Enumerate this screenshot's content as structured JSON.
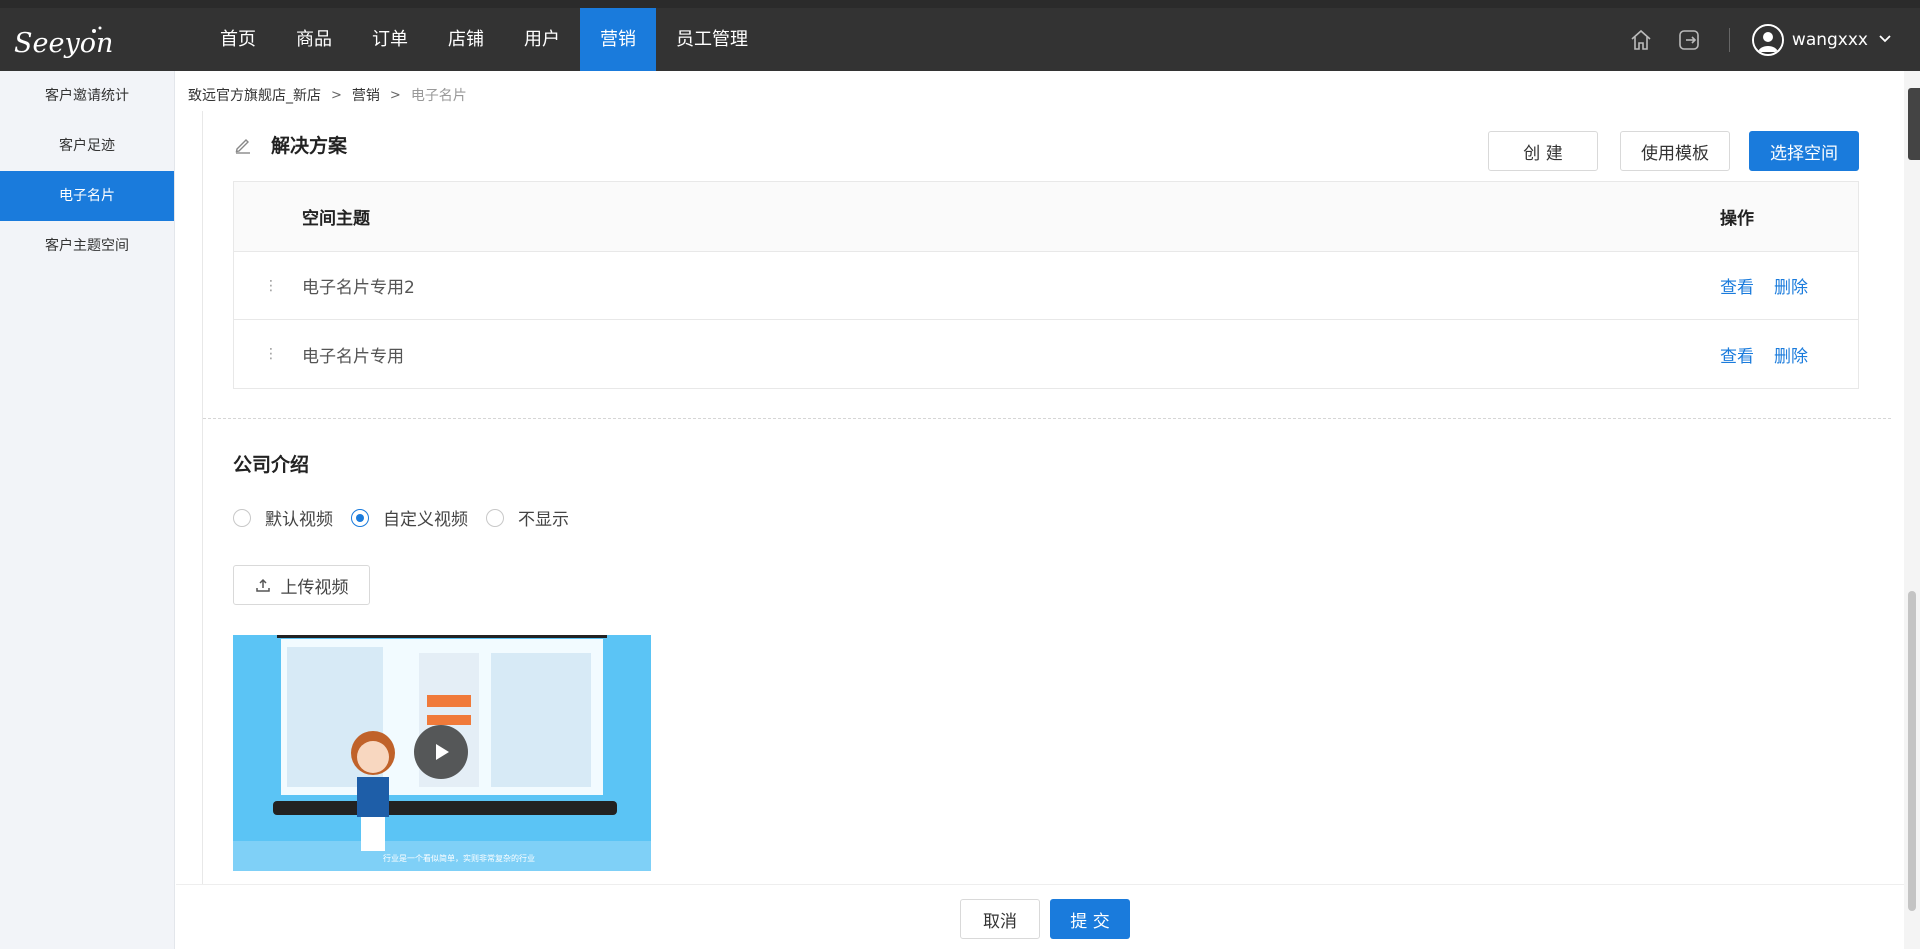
{
  "logo": {
    "text": "Seeyon"
  },
  "nav": {
    "items": [
      "首页",
      "商品",
      "订单",
      "店铺",
      "用户",
      "营销",
      "员工管理"
    ],
    "active_index": 5
  },
  "header": {
    "home_icon": "home-icon",
    "logout_icon": "logout-icon",
    "username": "wangxxx"
  },
  "sidebar": {
    "items": [
      {
        "label": "客户邀请统计"
      },
      {
        "label": "客户足迹"
      },
      {
        "label": "电子名片"
      },
      {
        "label": "客户主题空间"
      }
    ],
    "active_index": 2
  },
  "breadcrumb": {
    "items": [
      "致远官方旗舰店_新店",
      "营销",
      "电子名片"
    ],
    "separator": ">"
  },
  "solutions": {
    "title": "解决方案",
    "create_label": "创 建",
    "template_label": "使用模板",
    "select_label": "选择空间",
    "columns": {
      "topic": "空间主题",
      "ops": "操作"
    },
    "rows": [
      {
        "topic": "电子名片专用2",
        "view": "查看",
        "delete": "删除"
      },
      {
        "topic": "电子名片专用",
        "view": "查看",
        "delete": "删除"
      }
    ]
  },
  "company": {
    "title": "公司介绍",
    "radio_options": [
      "默认视频",
      "自定义视频",
      "不显示"
    ],
    "selected_index": 1,
    "upload_label": "上传视频",
    "video_caption": "行业是一个看似简单，实则非常复杂的行业"
  },
  "footer": {
    "cancel_label": "取消",
    "submit_label": "提 交"
  },
  "colors": {
    "primary": "#1a7bdc",
    "topbar": "#333333",
    "sidebar_bg": "#f2f4f8"
  }
}
